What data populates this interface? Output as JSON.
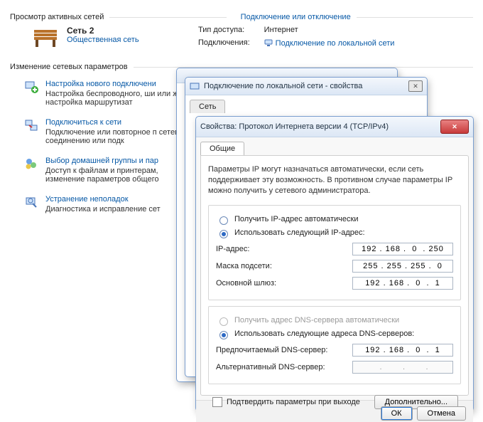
{
  "sections": {
    "activeNetworks": "Просмотр активных сетей",
    "connectLink": "Подключение или отключение",
    "network": {
      "name": "Сеть 2",
      "type": "Общественная сеть",
      "accessLabel": "Тип доступа:",
      "accessValue": "Интернет",
      "connectionsLabel": "Подключения:",
      "connectionsValue": "Подключение по локальной сети"
    },
    "changeParams": "Изменение сетевых параметров",
    "tasks": [
      {
        "title": "Настройка нового подключени",
        "desc": "Настройка беспроводного, ши\nили же настройка маршрутизат"
      },
      {
        "title": "Подключиться к сети",
        "desc": "Подключение или повторное п\nсетевому соединению или подк"
      },
      {
        "title": "Выбор домашней группы и пар",
        "desc": "Доступ к файлам и принтерам,\nизменение параметров общего"
      },
      {
        "title": "Устранение неполадок",
        "desc": "Диагностика и исправление сет"
      }
    ]
  },
  "win2": {
    "title": "Подключение по локальной сети - свойства",
    "tab": "Сеть"
  },
  "win3": {
    "title": "Свойства: Протокол Интернета версии 4 (TCP/IPv4)",
    "tab": "Общие",
    "infoText": "Параметры IP могут назначаться автоматически, если сеть поддерживает эту возможность. В противном случае параметры IP можно получить у сетевого администратора.",
    "radioAutoIP": "Получить IP-адрес автоматически",
    "radioManualIP": "Использовать следующий IP-адрес:",
    "ipLabel": "IP-адрес:",
    "ipValue": "192 . 168 .  0  . 250",
    "maskLabel": "Маска подсети:",
    "maskValue": "255 . 255 . 255 .  0",
    "gwLabel": "Основной шлюз:",
    "gwValue": "192 . 168 .  0  .  1",
    "radioAutoDNS": "Получить адрес DNS-сервера автоматически",
    "radioManualDNS": "Использовать следующие адреса DNS-серверов:",
    "dns1Label": "Предпочитаемый DNS-сервер:",
    "dns1Value": "192 . 168 .  0  .  1",
    "dns2Label": "Альтернативный DNS-сервер:",
    "dns2Value": " .       .       .",
    "confirmOnExit": "Подтвердить параметры при выходе",
    "advanced": "Дополнительно...",
    "ok": "ОК",
    "cancel": "Отмена"
  }
}
